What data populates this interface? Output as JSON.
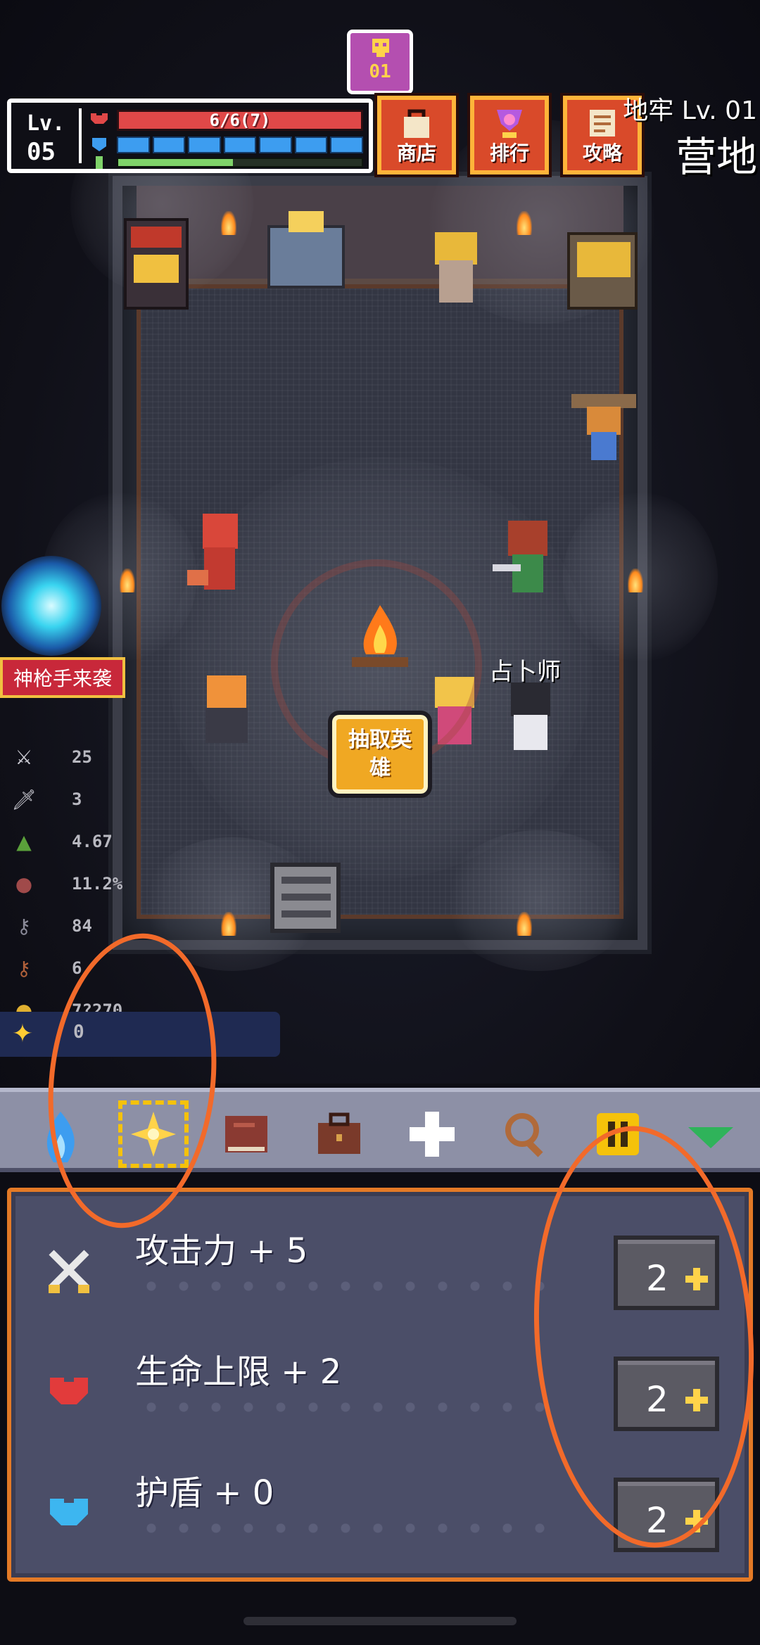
{
  "hud": {
    "level_label": "Lv.",
    "level_value": "05",
    "hp_text": "6/6(7)",
    "shield_segments": 7,
    "xp_progress": 0.47,
    "badge_text": "01"
  },
  "top_buttons": [
    {
      "label": "商店",
      "icon": "shop-bag-icon"
    },
    {
      "label": "排行",
      "icon": "trophy-gem-icon"
    },
    {
      "label": "攻略",
      "icon": "scroll-guide-icon"
    }
  ],
  "location": {
    "dungeon_level": "地牢 Lv. 01",
    "name": "营地"
  },
  "event": {
    "banner_text": "神枪手来袭"
  },
  "scene": {
    "draw_hero_label": "抽取英雄",
    "fortune_teller_label": "占卜师"
  },
  "stats": [
    {
      "icon": "crossed-swords-icon",
      "value": "25"
    },
    {
      "icon": "sword-icon",
      "value": "3"
    },
    {
      "icon": "boot-icon",
      "value": "4.67"
    },
    {
      "icon": "crit-orb-icon",
      "value": "11.2%"
    },
    {
      "icon": "key-icon",
      "value": "84"
    },
    {
      "icon": "key-red-icon",
      "value": "6"
    },
    {
      "icon": "coin-icon",
      "value": "7?270"
    }
  ],
  "points": {
    "icon": "sparkle-icon",
    "value": "0"
  },
  "toolbar": [
    {
      "name": "hero-tool",
      "icon": "blue-flame-icon",
      "active": false
    },
    {
      "name": "talent-tool",
      "icon": "sparkle-icon",
      "active": true
    },
    {
      "name": "book-tool",
      "icon": "book-icon",
      "active": false
    },
    {
      "name": "bag-tool",
      "icon": "briefcase-icon",
      "active": false
    },
    {
      "name": "heal-tool",
      "icon": "cross-icon",
      "active": false
    },
    {
      "name": "search-tool",
      "icon": "magnifier-icon",
      "active": false
    },
    {
      "name": "pause-tool",
      "icon": "pause-icon",
      "active": false
    },
    {
      "name": "more-tool",
      "icon": "green-chevron-icon",
      "active": false
    }
  ],
  "upgrades": [
    {
      "label": "攻击力 + 5",
      "icon": "crossed-swords-icon",
      "cost": "2",
      "color": "#e8e8e8"
    },
    {
      "label": "生命上限 + 2",
      "icon": "red-heart-icon",
      "cost": "2",
      "color": "#e23b3b"
    },
    {
      "label": "护盾 + 0",
      "icon": "blue-heart-icon",
      "cost": "2",
      "color": "#3db6f0"
    }
  ],
  "colors": {
    "accent_orange": "#e47a26",
    "hp_red": "#e04848",
    "shield_blue": "#3d9df0",
    "xp_green": "#7fd36a",
    "panel_bg": "#4b4e68",
    "annotation": "#f26a2a"
  }
}
